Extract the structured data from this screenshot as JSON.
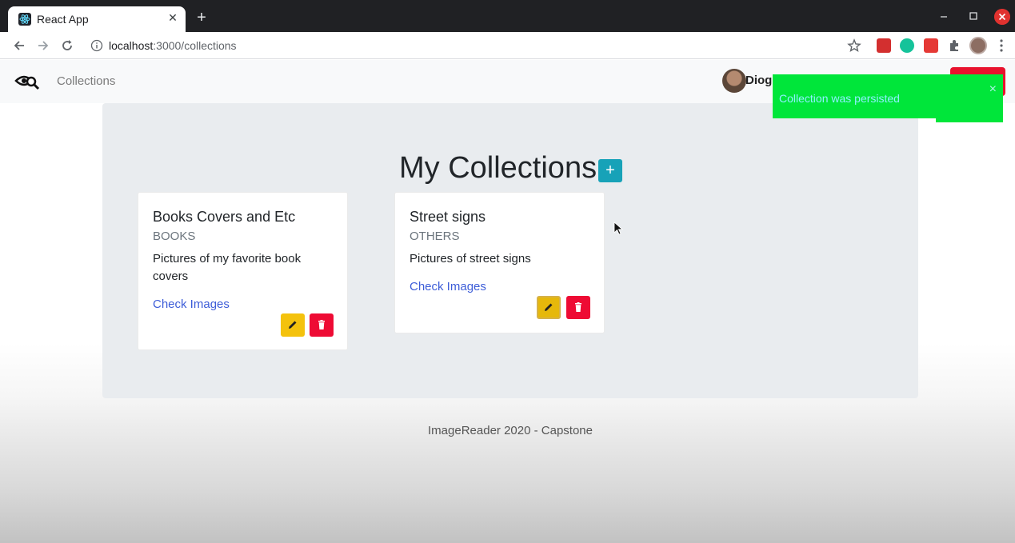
{
  "browser": {
    "tab_title": "React App",
    "url_host": "localhost",
    "url_path": ":3000/collections"
  },
  "navbar": {
    "nav_link": "Collections",
    "user_name": "Diogo",
    "brand_icon": "eye-search-icon"
  },
  "toast": {
    "message": "Collection was persisted",
    "close": "×",
    "color": "#00e63a"
  },
  "main": {
    "heading": "My Collections",
    "add_button": "+",
    "collections": [
      {
        "title": "Books Covers and Etc",
        "category": "BOOKS",
        "description": "Pictures of my favorite book covers",
        "link": "Check Images"
      },
      {
        "title": "Street signs",
        "category": "OTHERS",
        "description": "Pictures of street signs",
        "link": "Check Images"
      }
    ]
  },
  "footer": {
    "text": "ImageReader 2020 - Capstone"
  },
  "colors": {
    "accent_teal": "#17a2b8",
    "edit_yellow": "#f4c20d",
    "delete_red": "#ee0b34",
    "link_blue": "#3d5dd8"
  }
}
